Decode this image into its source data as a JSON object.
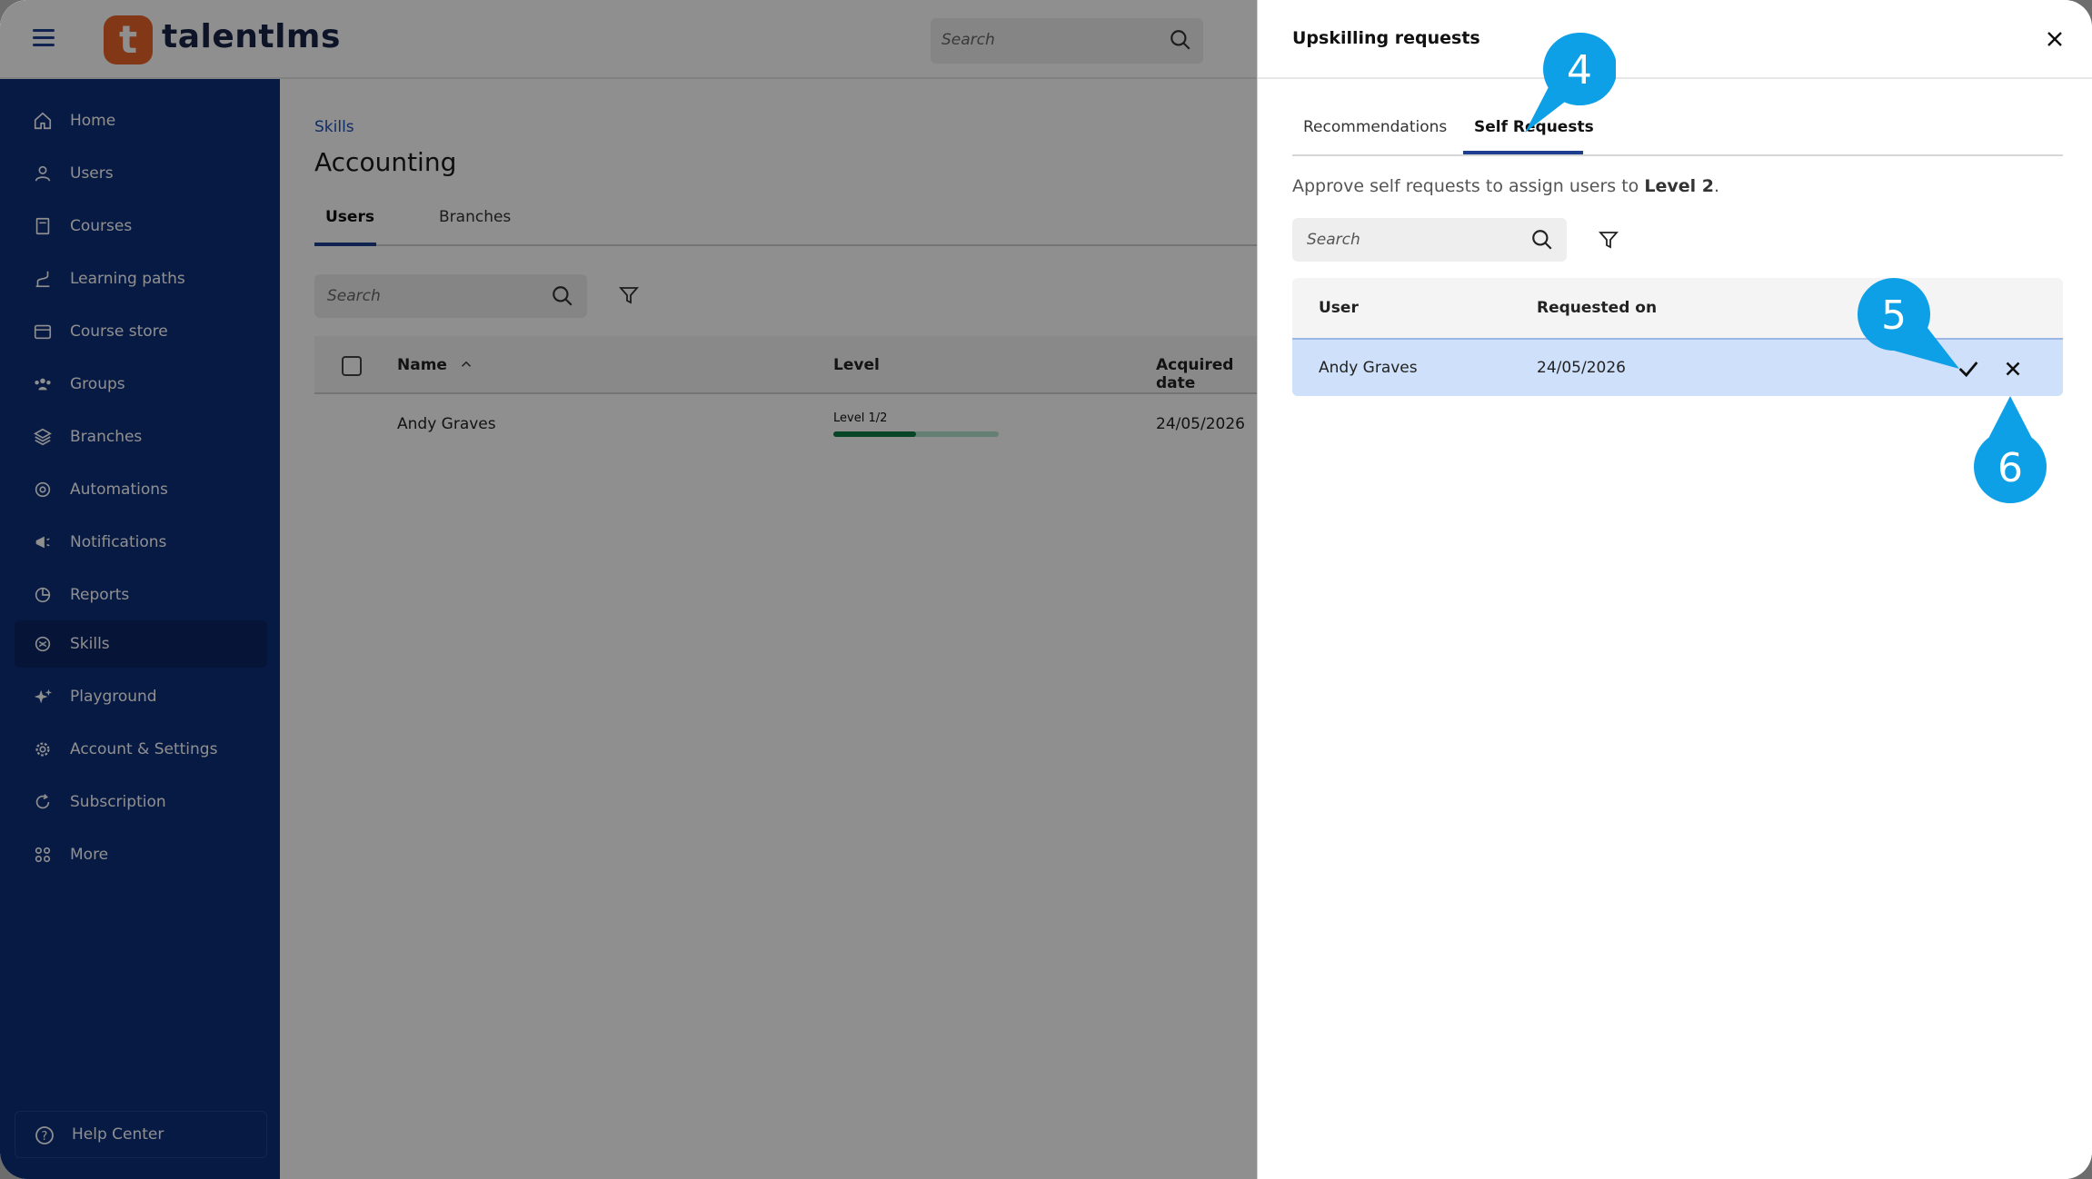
{
  "app": {
    "logo_letter": "t",
    "logo_text": "talentlms",
    "search_placeholder": "Search"
  },
  "sidebar": {
    "items": [
      {
        "label": "Home",
        "icon": "home-icon"
      },
      {
        "label": "Users",
        "icon": "user-icon"
      },
      {
        "label": "Courses",
        "icon": "book-icon"
      },
      {
        "label": "Learning paths",
        "icon": "path-icon"
      },
      {
        "label": "Course store",
        "icon": "store-icon"
      },
      {
        "label": "Groups",
        "icon": "groups-icon"
      },
      {
        "label": "Branches",
        "icon": "layers-icon"
      },
      {
        "label": "Automations",
        "icon": "automation-icon"
      },
      {
        "label": "Notifications",
        "icon": "megaphone-icon"
      },
      {
        "label": "Reports",
        "icon": "pie-chart-icon"
      },
      {
        "label": "Skills",
        "icon": "skills-icon",
        "active": true
      },
      {
        "label": "Playground",
        "icon": "sparkle-icon"
      },
      {
        "label": "Account & Settings",
        "icon": "gear-icon"
      },
      {
        "label": "Subscription",
        "icon": "refresh-icon"
      },
      {
        "label": "More",
        "icon": "grid-icon"
      }
    ],
    "help_label": "Help Center"
  },
  "content": {
    "breadcrumb": "Skills",
    "title": "Accounting",
    "tabs": [
      "Users",
      "Branches"
    ],
    "search_placeholder": "Search",
    "columns": {
      "name": "Name",
      "level": "Level",
      "acquired": "Acquired date"
    },
    "rows": [
      {
        "name": "Andy Graves",
        "level_label": "Level 1/2",
        "level_progress": 0.5,
        "acquired": "24/05/2026"
      }
    ]
  },
  "panel": {
    "title": "Upskilling requests",
    "tabs": [
      "Recommendations",
      "Self Requests"
    ],
    "active_tab": "Self Requests",
    "description_prefix": "Approve self requests to assign users to ",
    "description_level": "Level 2",
    "description_suffix": ".",
    "search_placeholder": "Search",
    "columns": {
      "user": "User",
      "requested_on": "Requested on"
    },
    "rows": [
      {
        "user": "Andy Graves",
        "requested_on": "24/05/2026"
      }
    ]
  },
  "callouts": [
    "4",
    "5",
    "6"
  ],
  "colors": {
    "sidebar": "#0e2f7a",
    "sidebar_active": "#0a2563",
    "accent": "#1d3d8f",
    "logo": "#e8622a",
    "callout": "#0ea0e6",
    "row_highlight": "#cfe0fa"
  }
}
